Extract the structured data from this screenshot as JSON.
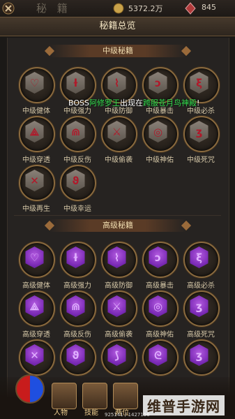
{
  "topbar": {
    "title_big": "秘 籍",
    "gold": "5372.2万",
    "gems": "845"
  },
  "title": "秘籍总览",
  "sections": [
    {
      "header": "中级秘籍",
      "items": [
        "中级健体",
        "中级强力",
        "中级防御",
        "中级暴击",
        "中级必杀",
        "中级穿透",
        "中级反伤",
        "中级偷袭",
        "中级神佑",
        "中级死咒",
        "中级再生",
        "中级幸运"
      ]
    },
    {
      "header": "高级秘籍",
      "items": [
        "高级健体",
        "高级强力",
        "高级防御",
        "高级暴击",
        "高级必杀",
        "高级穿透",
        "高级反伤",
        "高级偷袭",
        "高级神佑",
        "高级死咒"
      ]
    }
  ],
  "notice": {
    "p1": "BOSS",
    "p2": "阿修罗王",
    "p3": "出现在",
    "p4": "跨服苍月鸟神殿",
    "p5": "!"
  },
  "bottom": {
    "buttons": [
      "人物",
      "技能",
      "两位"
    ],
    "hp": "925141 / 1427156"
  },
  "watermark": "维普手游网",
  "colors": {
    "mid_gem": "#8a8178",
    "adv_gem": "#7b2ab5",
    "notice_green": "#35e050"
  }
}
